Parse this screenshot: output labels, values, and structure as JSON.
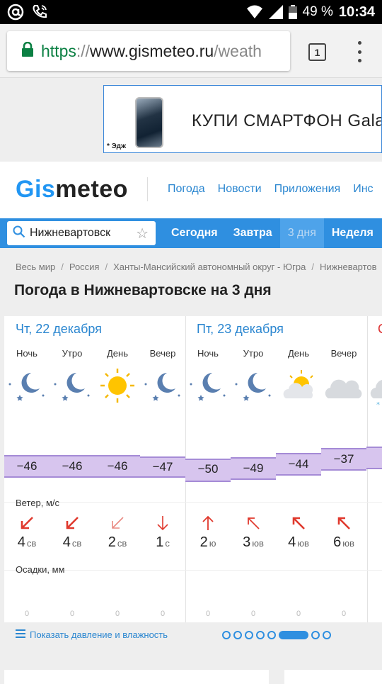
{
  "status": {
    "battery": "49 %",
    "time": "10:34"
  },
  "browser": {
    "url_scheme": "https",
    "url_sep": "://",
    "url_host": "www.gismeteo.ru",
    "url_path": "/weath",
    "tab_count": "1"
  },
  "ad": {
    "title": "КУПИ СМАРТФОН Gala",
    "fine_print": "* Эдж"
  },
  "site": {
    "logo_part1": "Gis",
    "logo_part2": "meteo",
    "nav": [
      "Погода",
      "Новости",
      "Приложения",
      "Инс"
    ]
  },
  "search": {
    "value": "Нижневартовск"
  },
  "periods": [
    {
      "label": "Сегодня",
      "active": false
    },
    {
      "label": "Завтра",
      "active": false
    },
    {
      "label": "3 дня",
      "active": true
    },
    {
      "label": "Неделя",
      "active": false
    }
  ],
  "breadcrumb": [
    "Весь мир",
    "Россия",
    "Ханты-Мансийский автономный округ - Югра",
    "Нижневартов"
  ],
  "page_title": "Погода в Нижневартовске на 3 дня",
  "forecast": {
    "days": [
      {
        "title": "Чт, 22 декабря"
      },
      {
        "title": "Пт, 23 декабря"
      },
      {
        "title": "С"
      }
    ],
    "period_labels": [
      "Ночь",
      "Утро",
      "День",
      "Вечер",
      "Ночь",
      "Утро",
      "День",
      "Вечер"
    ],
    "slots": [
      {
        "icon": "moon-stars-icon",
        "temp": "−46",
        "wind_speed": "4",
        "wind_dir": "св",
        "precip": "0"
      },
      {
        "icon": "moon-stars-icon",
        "temp": "−46",
        "wind_speed": "4",
        "wind_dir": "св",
        "precip": "0"
      },
      {
        "icon": "sun-icon",
        "temp": "−46",
        "wind_speed": "2",
        "wind_dir": "св",
        "precip": "0"
      },
      {
        "icon": "moon-stars-icon",
        "temp": "−47",
        "wind_speed": "1",
        "wind_dir": "с",
        "precip": "0"
      },
      {
        "icon": "moon-stars-icon",
        "temp": "−50",
        "wind_speed": "2",
        "wind_dir": "ю",
        "precip": "0"
      },
      {
        "icon": "moon-stars-icon",
        "temp": "−49",
        "wind_speed": "3",
        "wind_dir": "юв",
        "precip": "0"
      },
      {
        "icon": "sun-cloud-icon",
        "temp": "−44",
        "wind_speed": "4",
        "wind_dir": "юв",
        "precip": "0"
      },
      {
        "icon": "cloud-icon",
        "temp": "−37",
        "wind_speed": "6",
        "wind_dir": "юв",
        "precip": "0"
      }
    ],
    "wind_label": "Ветер, м/с",
    "precip_label": "Осадки, мм"
  },
  "footer": {
    "more_link": "Показать давление и влажность"
  },
  "colors": {
    "brand_blue": "#2f8fe0",
    "link_blue": "#2a86d0",
    "temp_band": "#d7c5ee",
    "wind_arrow": "#e0392d"
  }
}
